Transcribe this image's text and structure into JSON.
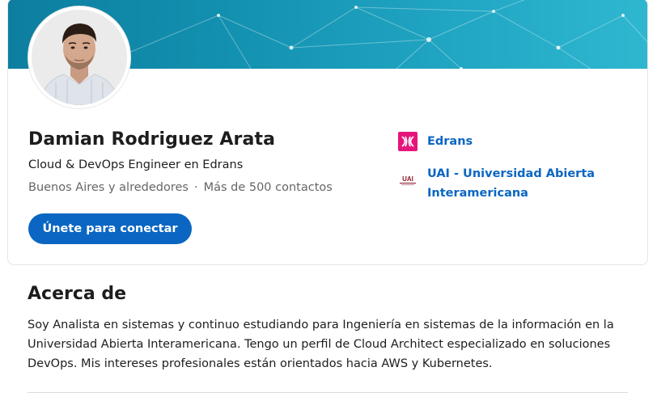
{
  "profile": {
    "name": "Damian Rodriguez Arata",
    "headline": "Cloud & DevOps Engineer en Edrans",
    "location": "Buenos Aires y alrededores",
    "separator": "·",
    "connections": "Más de 500 contactos",
    "connect_label": "Únete para conectar"
  },
  "experience": {
    "company": "Edrans",
    "company_icon": "edrans-logo-icon",
    "school": "UAI - Universidad Abierta Interamericana",
    "school_icon": "uai-logo-icon"
  },
  "about": {
    "title": "Acerca de",
    "text": "Soy Analista en sistemas y continuo estudiando para Ingeniería en sistemas de la información en la Universidad Abierta Interamericana. Tengo un perfil de Cloud Architect especializado en soluciones DevOps. Mis intereses profesionales están orientados hacia AWS y Kubernetes."
  },
  "colors": {
    "accent": "#0a66c2",
    "edrans_brand": "#e5157c",
    "uai_brand": "#8b1a2b",
    "cover": "#1391b0"
  }
}
